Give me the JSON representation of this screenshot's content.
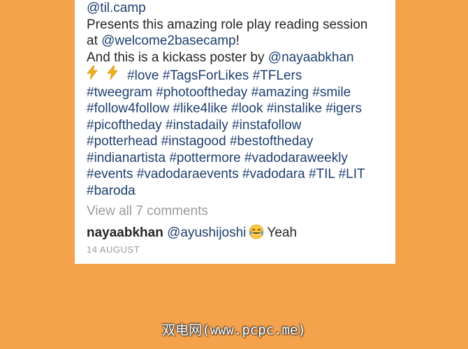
{
  "post": {
    "caption": {
      "mention_til": "@til.camp",
      "presents": "Presents this amazing role play reading session",
      "at": "at ",
      "mention_basecamp": "@welcome2basecamp",
      "exclaim": "!",
      "poster_text": "And this is a kickass poster by ",
      "mention_nayaab": "@nayaabkhan",
      "bolt_icon": "high-voltage-emoji",
      "hashtag_lines": [
        [
          "#love",
          "#TagsForLikes",
          "#TFLers"
        ],
        [
          "#tweegram",
          "#photooftheday",
          "#amazing",
          "#smile"
        ],
        [
          "#follow4follow",
          "#like4like",
          "#look",
          "#instalike",
          "#igers"
        ],
        [
          "#picoftheday",
          "#instadaily",
          "#instafollow"
        ],
        [
          "#potterhead",
          "#instagood",
          "#bestoftheday"
        ],
        [
          "#indianartista",
          "#pottermore",
          "#vadodaraweekly"
        ],
        [
          "#events",
          "#vadodaraevents",
          "#vadodara",
          "#TIL",
          "#LIT"
        ],
        [
          "#baroda"
        ]
      ]
    },
    "view_comments": "View all 7 comments",
    "comment": {
      "user": "nayaabkhan",
      "mention": "@ayushijoshi",
      "emoji_icon": "tears-of-joy-emoji",
      "text": "Yeah"
    },
    "date": "14 AUGUST"
  },
  "watermark": "双电网(www.pcpc.me)",
  "colors": {
    "background": "#F5A24C",
    "link": "#1F3F70",
    "muted": "#9B9B9B"
  }
}
